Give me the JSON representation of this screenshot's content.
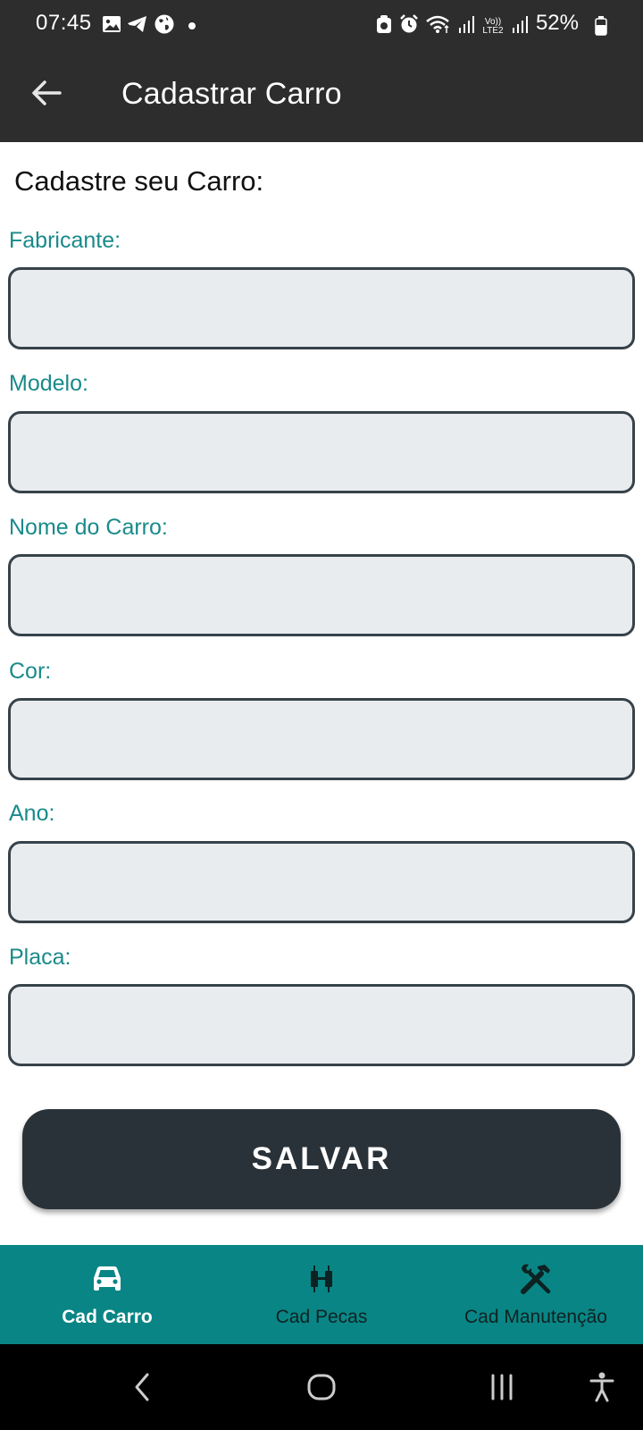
{
  "status_bar": {
    "time": "07:45",
    "battery": "52%",
    "icons_left": [
      "gallery-icon",
      "telegram-icon",
      "globe-icon",
      "dot-icon"
    ],
    "icons_right": [
      "save-mode-icon",
      "alarm-icon",
      "wifi-icon",
      "signal-icon",
      "volte-icon",
      "signal-icon-2",
      "battery-icon"
    ],
    "volte_label": "Vo)) LTE2"
  },
  "app_bar": {
    "title": "Cadastrar Carro",
    "back_icon": "arrow-left-icon"
  },
  "form": {
    "heading": "Cadastre seu Carro:",
    "fields": [
      {
        "label": "Fabricante:",
        "value": ""
      },
      {
        "label": "Modelo:",
        "value": ""
      },
      {
        "label": "Nome do Carro:",
        "value": ""
      },
      {
        "label": "Cor:",
        "value": ""
      },
      {
        "label": "Ano:",
        "value": ""
      },
      {
        "label": "Placa:",
        "value": ""
      }
    ],
    "save_label": "SALVAR"
  },
  "bottom_nav": {
    "items": [
      {
        "label": "Cad Carro",
        "icon": "car-icon",
        "active": true
      },
      {
        "label": "Cad Pecas",
        "icon": "car-parts-icon",
        "active": false
      },
      {
        "label": "Cad Manutenção",
        "icon": "tools-icon",
        "active": false
      }
    ]
  },
  "system_nav": [
    "back-chevron-icon",
    "home-icon",
    "recents-icon",
    "accessibility-icon"
  ],
  "colors": {
    "bar_background": "#2d2d2d",
    "label_teal": "#1a8a8a",
    "input_background": "#e9ecef",
    "input_border": "#37424a",
    "button_background": "#2a3239",
    "bottom_nav_background": "#0a8585"
  }
}
